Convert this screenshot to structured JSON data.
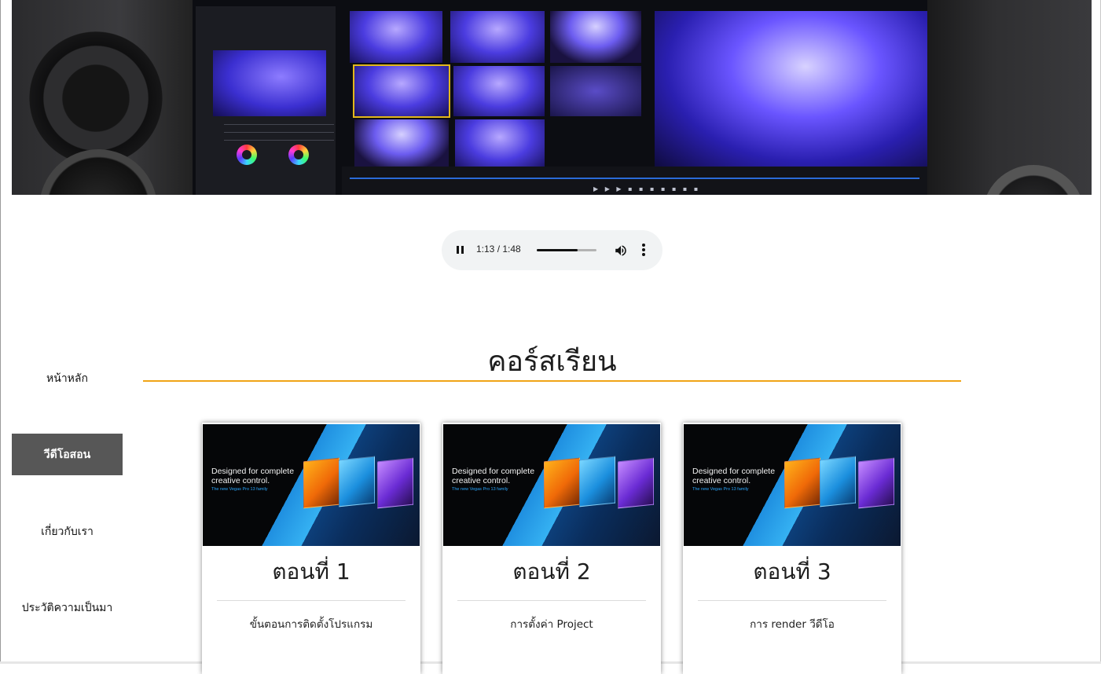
{
  "audio": {
    "time": "1:13 / 1:48",
    "progress": 0.68
  },
  "nav": {
    "items": [
      {
        "label": "หน้าหลัก",
        "active": false
      },
      {
        "label": "วีดีโอสอน",
        "active": true
      },
      {
        "label": "เกี่ยวกับเรา",
        "active": false
      },
      {
        "label": "ประวัติความเป็นมา",
        "active": false
      }
    ]
  },
  "section": {
    "title": "คอร์สเรียน",
    "accent": "#f0a417"
  },
  "card_image": {
    "headline": "Designed for complete creative control.",
    "subline": "The new Vegas Pro 13 family"
  },
  "cards": [
    {
      "title": "ตอนที่ 1",
      "desc": "ขั้นตอนการติดตั้งโปรแกรม"
    },
    {
      "title": "ตอนที่ 2",
      "desc": "การตั้งค่า Project"
    },
    {
      "title": "ตอนที่ 3",
      "desc": "การ render วีดีโอ"
    }
  ],
  "colors": {
    "nav_active_bg": "#575757",
    "audio_bg": "#f1f3f4"
  }
}
